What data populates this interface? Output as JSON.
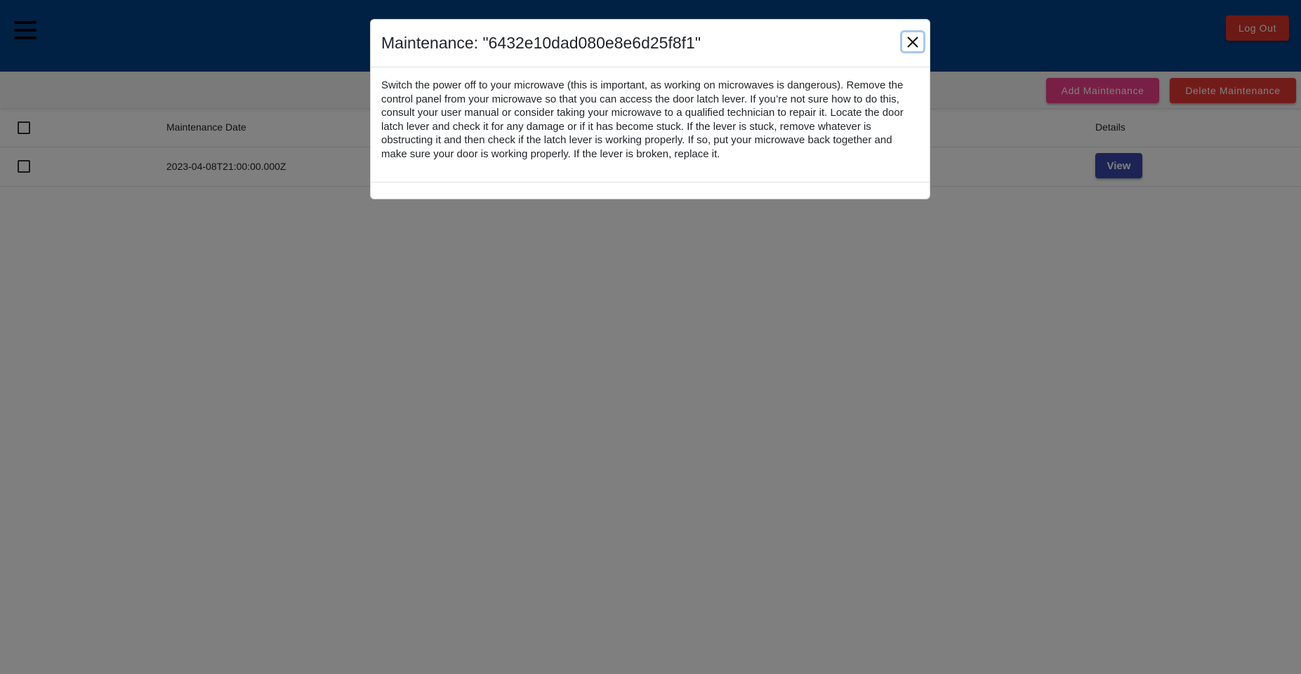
{
  "header": {
    "menu_icon": "hamburger-menu-icon",
    "logout_label": "Log Out",
    "background": "#004287"
  },
  "toolbar": {
    "add_label": "Add Maintenance",
    "delete_label": "Delete Maintenance"
  },
  "table": {
    "columns": {
      "date": "Maintenance Date",
      "details": "Details"
    },
    "rows": [
      {
        "date": "2023-04-08T21:00:00.000Z",
        "action_label": "View"
      }
    ]
  },
  "modal": {
    "title": "Maintenance: \"6432e10dad080e8e6d25f8f1\"",
    "close_icon": "close-x-icon",
    "body": "Switch the power off to your microwave (this is important, as working on microwaves is dangerous). Remove the control panel from your microwave so that you can access the door latch lever. If you’re not sure how to do this, consult your user manual or consider taking your microwave to a qualified technician to repair it. Locate the door latch lever and check it for any damage or if it has become stuck. If the lever is stuck, remove whatever is obstructing it and then check if the latch lever is working properly. If so, put your microwave back together and make sure your door is working properly. If the lever is broken, replace it."
  },
  "colors": {
    "header_blue": "#004287",
    "logout_red": "#d9342b",
    "add_pink": "#f03e8a",
    "delete_red": "#e53935",
    "view_indigo": "#3949ab"
  }
}
